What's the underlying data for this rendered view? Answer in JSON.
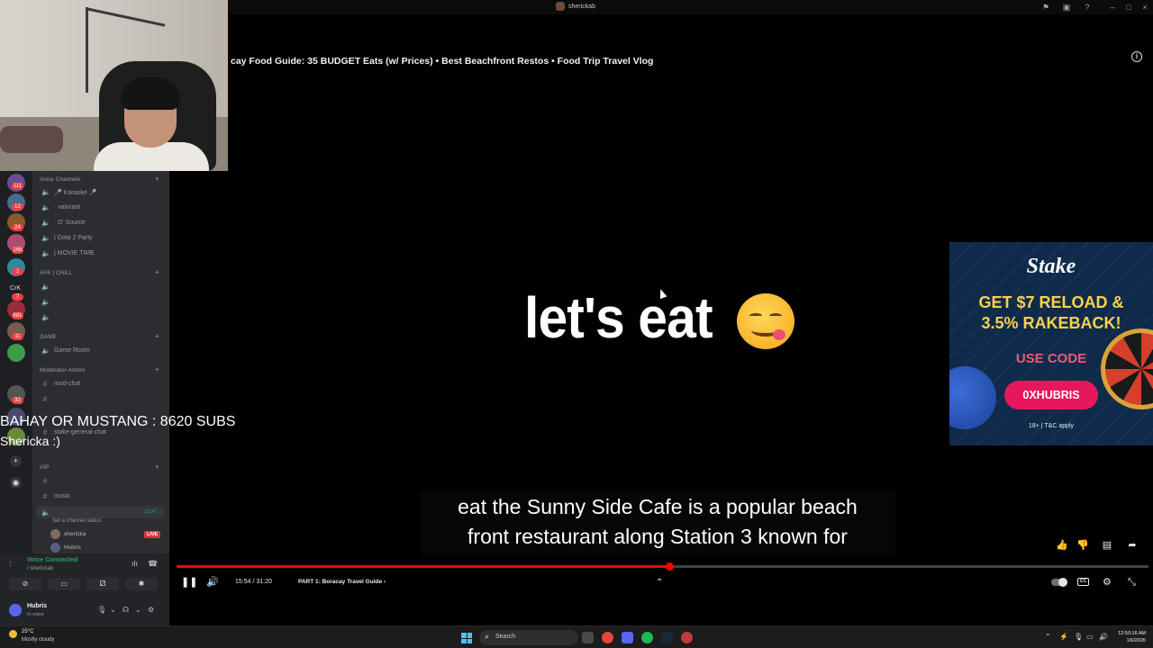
{
  "titlebar": {
    "server_name": "sherickab"
  },
  "video": {
    "title": "cay Food Guide: 35 BUDGET Eats (w/ Prices) • Best Beachfront Restos • Food Trip Travel Vlog",
    "big_text": "let's eat",
    "caption_line1": "eat the Sunny Side Cafe is a popular beach",
    "caption_line2": "front restaurant along Station 3 known for",
    "time": "15:54 / 31:20",
    "chapter": "PART 1: Boracay Travel Guide",
    "progress": 0.5074,
    "loaded": 0.51
  },
  "ad": {
    "logo": "Stake",
    "headline_line1": "GET $7 RELOAD &",
    "headline_line2": "3.5% RAKEBACK!",
    "use_code": "USE CODE",
    "code": "0XHUBRIS",
    "tnc": "18+ | T&C apply"
  },
  "overlay": {
    "line1": "BAHAY OR MUSTANG : 8620 SUBS",
    "line2": "Shericka :)"
  },
  "rail": {
    "badges": [
      "111",
      "12",
      "24",
      "166",
      "2",
      "7",
      "681",
      "11",
      "32"
    ],
    "text_server": "CrK"
  },
  "channels": {
    "cat_voice": "Voice Channels",
    "karaoke": "🎤 Karaoke 🎤",
    "valorant": "· valorant",
    "d_source": "· D' Source",
    "dota": "| Dota 2 Party",
    "movie": "| MOVIE TIME",
    "cat_afk": "AFK | CHILL",
    "cat_game": "GAME",
    "game_room": "Game Room",
    "cat_mod": "Moderator-Admin",
    "mod_chat": "mod-chat",
    "stake_chat": "stake-general-chat",
    "cat_vip": "VIP",
    "music": "music",
    "active_time": "21:47",
    "set_status": "Set a channel status",
    "user1": "shericka",
    "user1_badge": "LIVE",
    "user2": "Hubris"
  },
  "voice": {
    "status": "Voice Connected",
    "channel": "/ sherickab",
    "username": "Hubris",
    "user_status": "In voice"
  },
  "taskbar": {
    "temp": "25°C",
    "weather": "Mostly cloudy",
    "search": "Search",
    "time": "12:50:16 AM",
    "date": "1/6/2026"
  },
  "colors": {
    "accent": "#ff0000",
    "discord_bg": "#2b2d31",
    "discord_green": "#23a55a",
    "ad_pink": "#e8175d",
    "ad_yellow": "#f7d34b"
  }
}
